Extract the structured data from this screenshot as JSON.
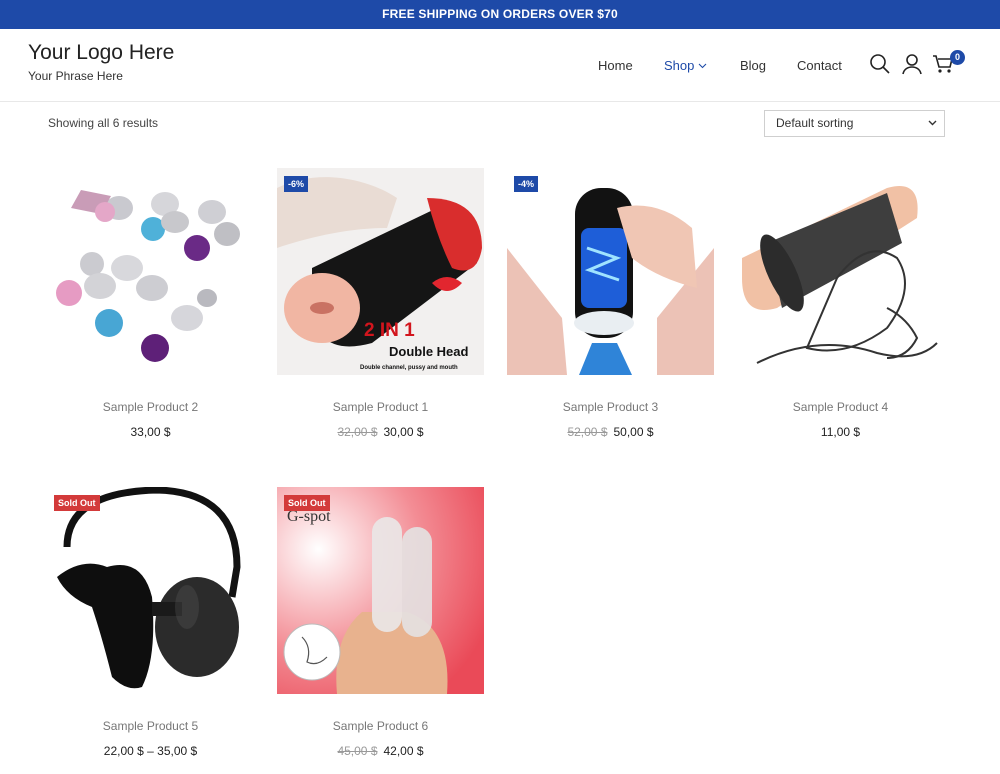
{
  "announcement": "FREE SHIPPING ON ORDERS OVER $70",
  "brand": {
    "logo": "Your Logo Here",
    "phrase": "Your Phrase Here"
  },
  "nav": {
    "home": "Home",
    "shop": "Shop",
    "blog": "Blog",
    "contact": "Contact"
  },
  "cart": {
    "count": "0"
  },
  "icons": [
    "search-icon",
    "user-icon",
    "cart-icon",
    "chevron-down-icon"
  ],
  "accent_color": "#1e4aa8",
  "sold_out_color": "#d33a3a",
  "shop": {
    "results": "Showing all 6 results",
    "sort": {
      "selected": "Default sorting"
    }
  },
  "products": [
    {
      "name": "Sample Product 2",
      "price": "33,00 $",
      "old_price": "",
      "badge": ""
    },
    {
      "name": "Sample Product 1",
      "price": "30,00 $",
      "old_price": "32,00 $",
      "badge": "-6%",
      "image_text": {
        "line1": "2 IN 1",
        "line2": "Double Head",
        "line3": "Double channel, pussy and mouth"
      }
    },
    {
      "name": "Sample Product 3",
      "price": "50,00 $",
      "old_price": "52,00 $",
      "badge": "-4%"
    },
    {
      "name": "Sample Product 4",
      "price": "11,00 $",
      "old_price": "",
      "badge": ""
    },
    {
      "name": "Sample Product 5",
      "price": "22,00 $ – 35,00 $",
      "old_price": "",
      "badge": "Sold Out"
    },
    {
      "name": "Sample Product 6",
      "price": "42,00 $",
      "old_price": "45,00 $",
      "badge": "Sold Out",
      "image_text": {
        "line1": "G-spot"
      }
    }
  ]
}
